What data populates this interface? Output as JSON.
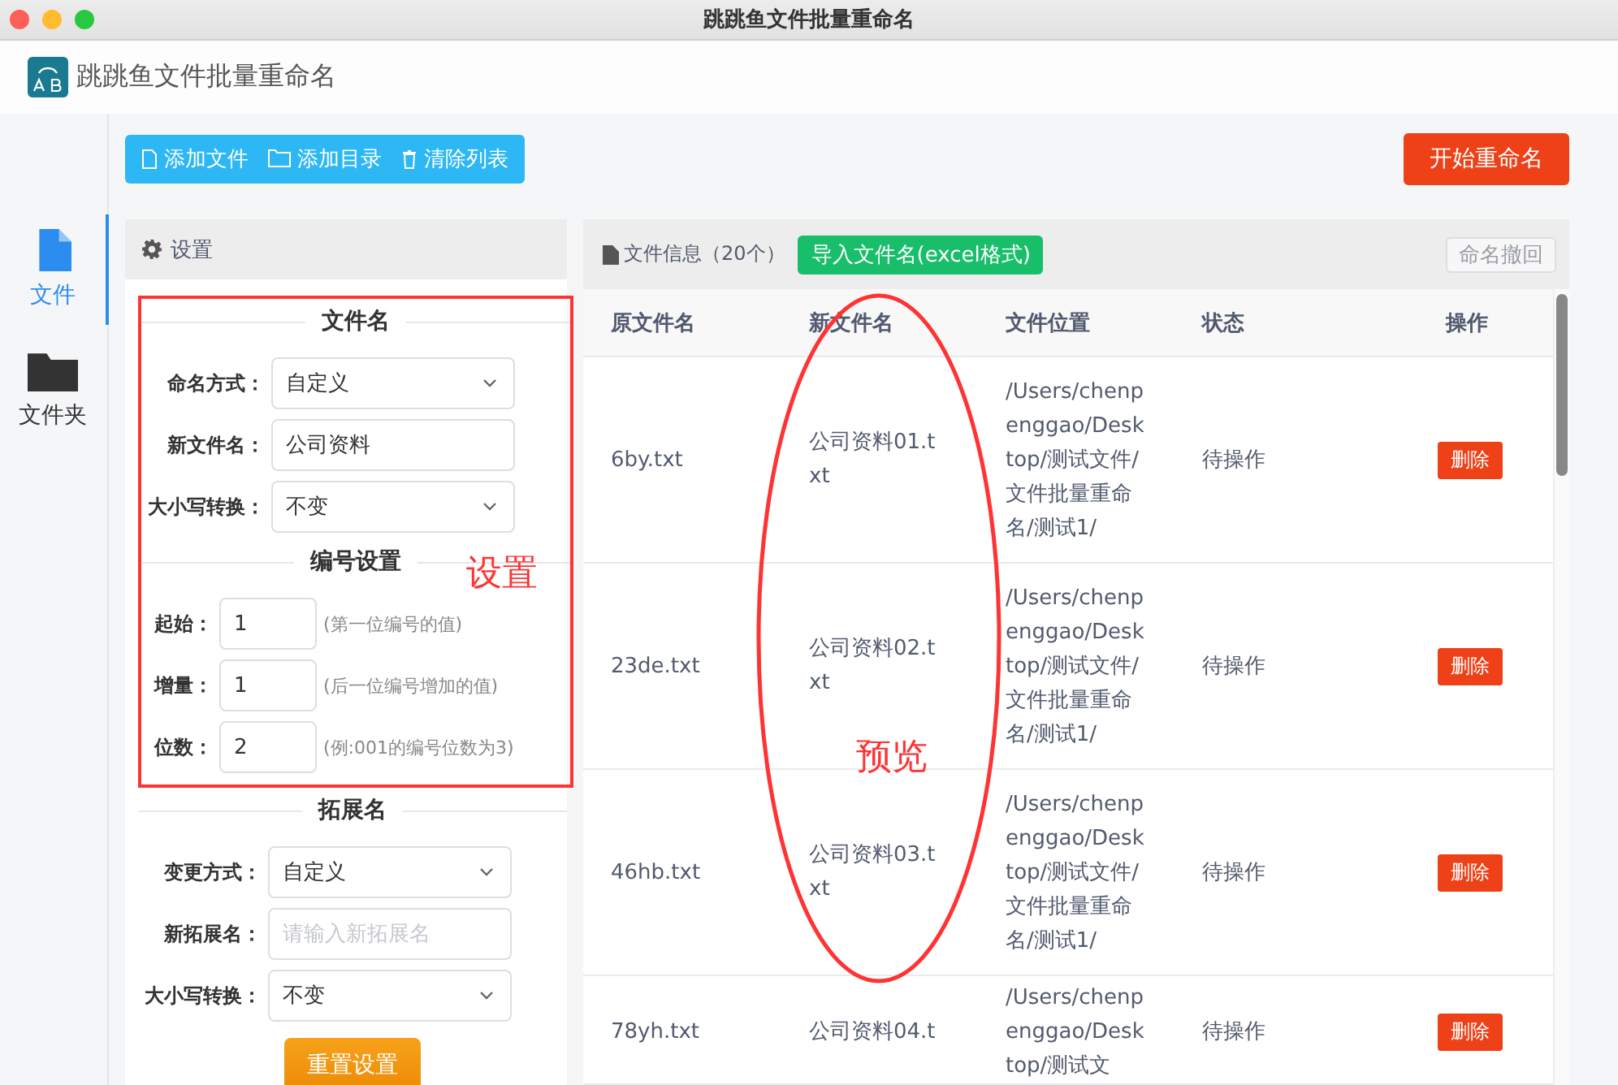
{
  "window": {
    "title": "跳跳鱼文件批量重命名"
  },
  "app_header": {
    "title": "跳跳鱼文件批量重命名"
  },
  "nav": [
    {
      "label": "文件",
      "kind": "file",
      "selected": true
    },
    {
      "label": "文件夹",
      "kind": "folder",
      "selected": false
    }
  ],
  "toolbar": {
    "buttons": [
      {
        "label": "添加文件",
        "kind": "file"
      },
      {
        "label": "添加目录",
        "kind": "folder"
      },
      {
        "label": "清除列表",
        "kind": "trash"
      }
    ],
    "start_button": "开始重命名"
  },
  "settings": {
    "title": "设置",
    "sections": [
      {
        "title": "文件名",
        "fields": [
          {
            "kind": "select",
            "label": "命名方式：",
            "value": "自定义"
          },
          {
            "kind": "text",
            "label": "新文件名：",
            "value": "公司资料"
          },
          {
            "kind": "select",
            "label": "大小写转换：",
            "value": "不变"
          }
        ]
      },
      {
        "title": "编号设置",
        "fields": [
          {
            "kind": "number",
            "label": "起始：",
            "value": "1",
            "hint": "(第一位编号的值)"
          },
          {
            "kind": "number",
            "label": "增量：",
            "value": "1",
            "hint": "(后一位编号增加的值)"
          },
          {
            "kind": "number",
            "label": "位数：",
            "value": "2",
            "hint": "(例:001的编号位数为3)"
          }
        ]
      },
      {
        "title": "拓展名",
        "fields": [
          {
            "kind": "select",
            "label": "变更方式：",
            "value": "自定义"
          },
          {
            "kind": "text",
            "label": "新拓展名：",
            "placeholder": "请输入新拓展名"
          },
          {
            "kind": "select",
            "label": "大小写转换：",
            "value": "不变"
          }
        ]
      }
    ],
    "reset_button": "重置设置"
  },
  "file_panel": {
    "title": "文件信息（20个）",
    "import_button": "导入文件名(excel格式)",
    "undo_button": {
      "label": "命名撤回",
      "disabled": true
    },
    "table": {
      "columns": [
        "原文件名",
        "新文件名",
        "文件位置",
        "状态",
        "操作"
      ],
      "rows": [
        {
          "original": "6by.txt",
          "new_name": "公司资料01.txt",
          "location": "/Users/chenpenggao/Desktop/测试文件/文件批量重命名/测试1/",
          "status": "待操作",
          "action": "删除"
        },
        {
          "original": "23de.txt",
          "new_name": "公司资料02.txt",
          "location": "/Users/chenpenggao/Desktop/测试文件/文件批量重命名/测试1/",
          "status": "待操作",
          "action": "删除"
        },
        {
          "original": "46hb.txt",
          "new_name": "公司资料03.txt",
          "location": "/Users/chenpenggao/Desktop/测试文件/文件批量重命名/测试1/",
          "status": "待操作",
          "action": "删除"
        },
        {
          "original": "78yh.txt",
          "new_name": "公司资料04.t",
          "location": "/Users/chenpenggao/Desktop/测试文",
          "status": "待操作",
          "action": "删除"
        }
      ]
    }
  },
  "annotations": [
    {
      "kind": "frame",
      "label": "设置"
    },
    {
      "kind": "ellipse",
      "label": "预览"
    }
  ]
}
